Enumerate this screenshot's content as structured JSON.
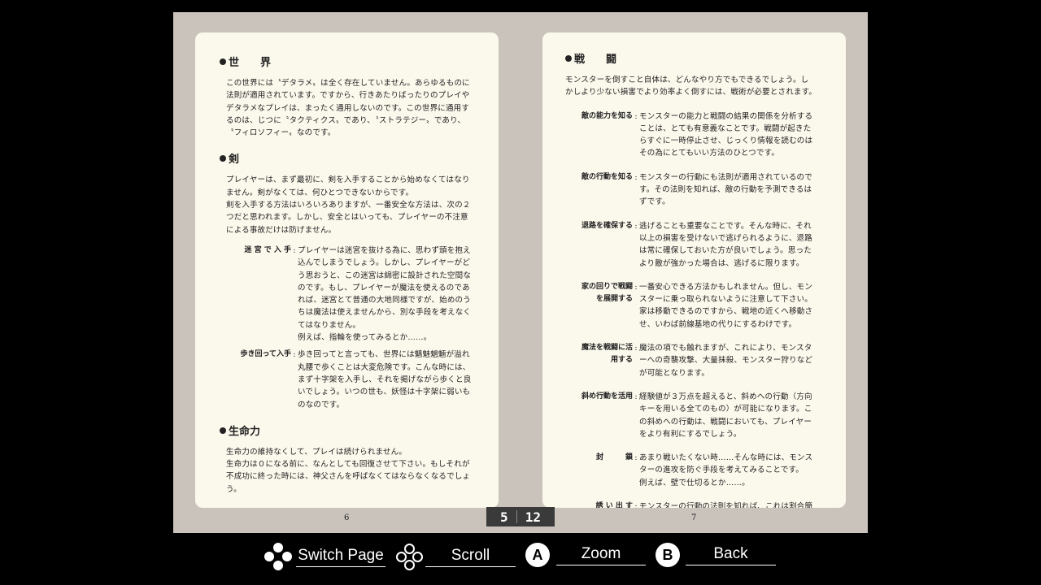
{
  "left_page": {
    "sections": [
      {
        "title": "世　　界",
        "paragraph": "この世界には〝デタラメ〟は全く存在していません。あらゆるものに\n法則が適用されています。ですから、行きあたりばったりのプレイや\nデタラメなプレイは、まったく通用しないのです。この世界に通用す\nるのは、じつに〝タクティクス〟であり、〝ストラテジー〟であり、\n〝フィロソフィー〟なのです。"
      },
      {
        "title": "剣",
        "paragraph": "プレイヤーは、まず最初に、剣を入手することから始めなくてはなり\nません。剣がなくては、何ひとつできないからです。\n剣を入手する方法はいろいろありますが、一番安全な方法は、次の２\nつだと思われます。しかし、安全とはいっても、プレイヤーの不注意\nによる事故だけは防げません。",
        "items": [
          {
            "term": "迷 宮 で 入 手",
            "desc": "プレイヤーは迷宮を抜ける為に、思わず頭を抱え\n込んでしまうでしょう。しかし、プレイヤーがど\nう思おうと、この迷宮は綿密に設計された空間な\nのです。もし、プレイヤーが魔法を使えるのであ\nれば、迷宮とて普通の大地同様ですが、始めのう\nちは魔法は使えませんから、別な手段を考えなく\nてはなりません。\n例えば、指輪を使ってみるとか……。"
          },
          {
            "term": "歩き回って入手",
            "desc": "歩き回ってと言っても、世界には魑魅魍魎が溢れ\n丸腰で歩くことは大変危険です。こんな時には、\nまず十字架を入手し、それを掲げながら歩くと良\nいでしょう。いつの世も、妖怪は十字架に弱いも\nのなのです。"
          }
        ]
      },
      {
        "title": "生命力",
        "paragraph": "生命力の維持なくして、プレイは続けられません。\n生命力は０になる前に、なんとしても回復させて下さい。もしそれが\n不成功に終った時には、神父さんを呼ばなくてはならなくなるでしょう。"
      }
    ],
    "page_number": "6"
  },
  "right_page": {
    "title": "戦　　闘",
    "intro": "モンスターを倒すこと自体は、どんなやり方でもできるでしょう。し\nかしより少ない損害でより効率よく倒すには、戦術が必要とされます。",
    "items": [
      {
        "term": "敵の能力を知る",
        "desc": "モンスターの能力と戦闘の結果の関係を分析する\nことは、とても有意義なことです。戦闘が起きた\nらすぐに一時停止させ、じっくり情報を読むのは\nその為にとてもいい方法のひとつです。"
      },
      {
        "term": "敵の行動を知る",
        "desc": "モンスターの行動にも法則が適用されているので\nす。その法則を知れば、敵の行動を予測できるは\nずです。"
      },
      {
        "term": "退路を確保する",
        "desc": "逃げることも重要なことです。そんな時に、それ\n以上の損害を受けないで逃げられるように、退路\nは常に確保しておいた方が良いでしょう。思った\nより敵が強かった場合は、逃げるに限ります。"
      },
      {
        "term": "家の回りで戦闘\nを展開する",
        "desc": "一番安心できる方法かもしれません。但し、モン\nスターに乗っ取られないように注意して下さい。\n家は移動できるのですから、戦地の近くへ移動さ\nせ、いわば前線基地の代りにするわけです。"
      },
      {
        "term": "魔法を戦闘に活\n用する",
        "desc": "魔法の項でも触れますが、これにより、モンスタ\nーへの奇襲攻撃、大量抹殺、モンスター狩りなど\nが可能となります。"
      },
      {
        "term": "斜め行動を活用",
        "desc": "経験値が３万点を超えると、斜めへの行動（方向\nキーを用いる全てのもの）が可能になります。こ\nの斜めへの行動は、戦闘においても、プレイヤー\nをより有利にするでしょう。"
      },
      {
        "term": "封　　　鎖",
        "desc": "あまり戦いたくない時……そんな時には、モンス\nターの進攻を防ぐ手段を考えてみることです。\n例えば、壁で仕切るとか……。"
      },
      {
        "term": "誘 い 出 す",
        "desc": "モンスターの行動の法則を知れば、これは割合簡"
      }
    ],
    "page_number": "7"
  },
  "counter": {
    "current": "5",
    "total": "12"
  },
  "controls": {
    "switch_page": "Switch Page",
    "scroll": "Scroll",
    "zoom_key": "A",
    "zoom": "Zoom",
    "back_key": "B",
    "back": "Back"
  }
}
